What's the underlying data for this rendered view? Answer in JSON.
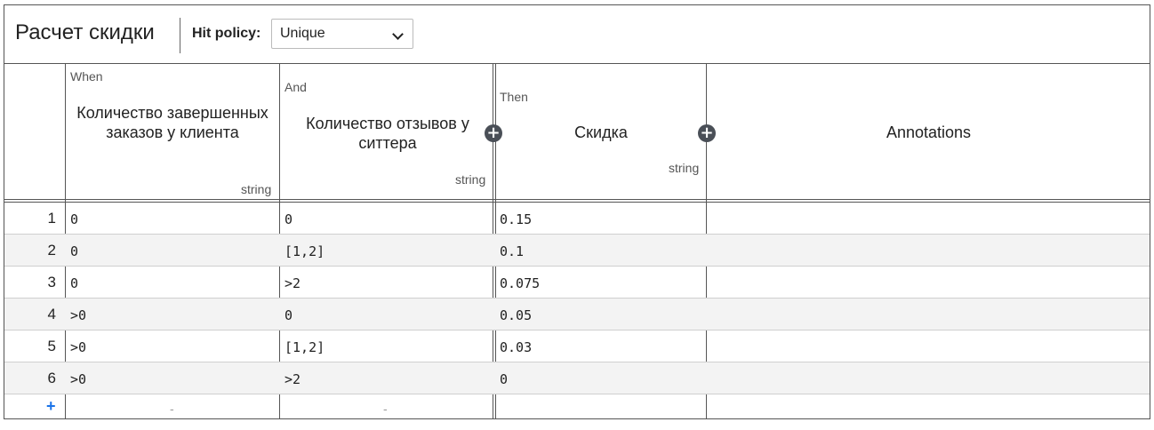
{
  "header": {
    "table_name": "Расчет скидки",
    "hit_policy_label": "Hit policy:",
    "hit_policy_value": "Unique"
  },
  "columns": [
    {
      "tag": "When",
      "label": "Количество завершенных заказов у клиента",
      "type": "string"
    },
    {
      "tag": "And",
      "label": "Количество отзывов у ситтера",
      "type": "string"
    },
    {
      "tag": "Then",
      "label": "Скидка",
      "type": "string"
    },
    {
      "tag": "",
      "label": "Annotations",
      "type": ""
    }
  ],
  "rows": [
    {
      "num": "1",
      "c1": "0",
      "c2": "0",
      "c3": "0.15",
      "ann": ""
    },
    {
      "num": "2",
      "c1": "0",
      "c2": "[1,2]",
      "c3": "0.1",
      "ann": ""
    },
    {
      "num": "3",
      "c1": "0",
      "c2": ">2",
      "c3": "0.075",
      "ann": ""
    },
    {
      "num": "4",
      "c1": ">0",
      "c2": "0",
      "c3": "0.05",
      "ann": ""
    },
    {
      "num": "5",
      "c1": ">0",
      "c2": "[1,2]",
      "c3": "0.03",
      "ann": ""
    },
    {
      "num": "6",
      "c1": ">0",
      "c2": ">2",
      "c3": "0",
      "ann": ""
    }
  ],
  "add_row": {
    "plus": "+",
    "dash1": "-",
    "dash2": "-"
  },
  "icons": {
    "add_input_column": "+",
    "add_output_column": "+",
    "dropdown": "chevron-down-icon"
  },
  "colors": {
    "border": "#555555",
    "alt_row": "#f3f3f3",
    "add_btn": "#4a4f57",
    "add_row": "#1a73e8"
  }
}
